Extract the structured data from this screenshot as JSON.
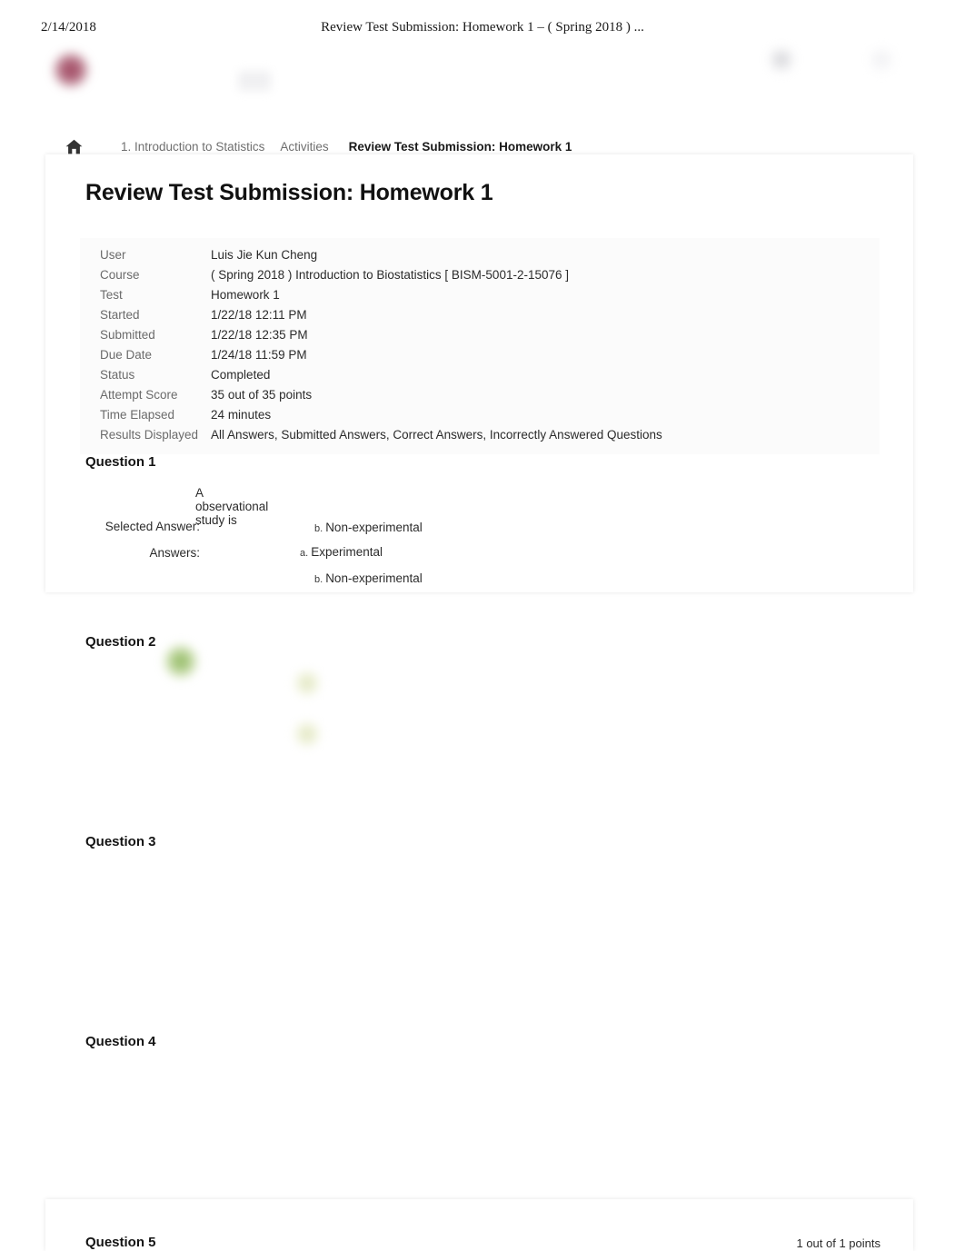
{
  "print_header": {
    "date": "2/14/2018",
    "title": "Review Test Submission: Homework 1 – ( Spring 2018 ) ..."
  },
  "header": {
    "logo_name": "university-logo",
    "bell_icon": "notifications-bell-icon",
    "account_icon": "account-avatar-icon"
  },
  "breadcrumb": {
    "home_icon": "home-icon",
    "items": [
      {
        "label": "1. Introduction to Statistics",
        "current": false
      },
      {
        "label": "Activities",
        "current": false
      },
      {
        "label": "Review Test Submission: Homework 1",
        "current": true
      }
    ]
  },
  "page": {
    "title": "Review Test Submission: Homework 1"
  },
  "info": {
    "rows": [
      {
        "label": "User",
        "value": "Luis Jie Kun Cheng"
      },
      {
        "label": "Course",
        "value": "( Spring 2018 ) Introduction to Biostatistics [ BISM-5001-2-15076 ]"
      },
      {
        "label": "Test",
        "value": "Homework 1"
      },
      {
        "label": "Started",
        "value": "1/22/18 12:11 PM"
      },
      {
        "label": "Submitted",
        "value": "1/22/18 12:35 PM"
      },
      {
        "label": "Due Date",
        "value": "1/24/18 11:59 PM"
      },
      {
        "label": "Status",
        "value": "Completed"
      },
      {
        "label": "Attempt Score",
        "value": "35 out of 35 points"
      },
      {
        "label": "Time Elapsed",
        "value": "24 minutes"
      },
      {
        "label": "Results Displayed",
        "value": "All Answers, Submitted Answers, Correct Answers, Incorrectly Answered Questions"
      }
    ]
  },
  "questions": [
    {
      "heading": "Question 1",
      "points": "",
      "prompt": "A observational study is",
      "selected_label": "Selected Answer:",
      "selected_letter": "b.",
      "selected_text": "Non-experimental",
      "answers_label": "Answers:",
      "options": [
        {
          "letter": "a.",
          "text": "Experimental",
          "correct": false
        },
        {
          "letter": "b.",
          "text": "Non-experimental",
          "correct": true
        }
      ]
    },
    {
      "heading": "Question 2",
      "points": ""
    },
    {
      "heading": "Question 3",
      "points": ""
    },
    {
      "heading": "Question 4",
      "points": ""
    },
    {
      "heading": "Question 5",
      "points": "1 out of 1 points"
    }
  ],
  "colors": {
    "correct_green": "#76a83c",
    "brand_maroon": "#963450",
    "text_primary": "#262626",
    "text_muted": "#6b6b6b"
  }
}
